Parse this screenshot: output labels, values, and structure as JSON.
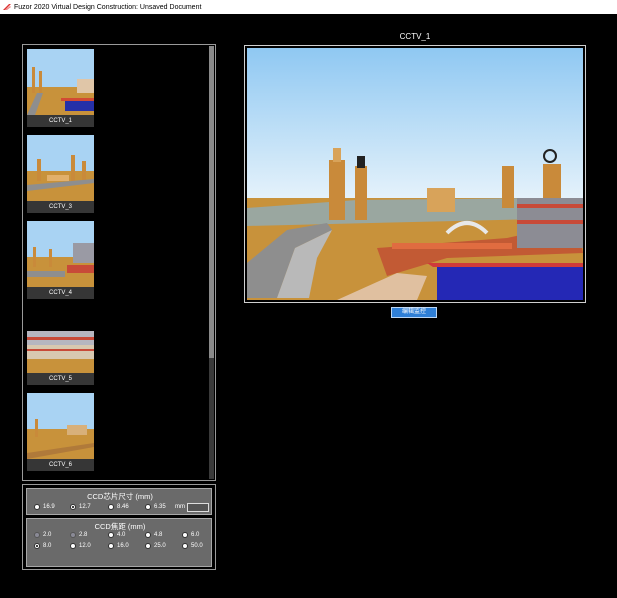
{
  "window": {
    "title": "Fuzor 2020 Virtual Design Construction: Unsaved Document"
  },
  "thumbnails": [
    {
      "label": "CCTV_1"
    },
    {
      "label": "CCTV_3"
    },
    {
      "label": "CCTV_4"
    },
    {
      "label": "CCTV_5"
    },
    {
      "label": "CCTV_6"
    }
  ],
  "main": {
    "title": "CCTV_1",
    "edit_button": "编辑监控"
  },
  "sensor": {
    "title": "CCD芯片尺寸 (mm)",
    "options": [
      "16.9",
      "12.7",
      "8.46",
      "6.35"
    ],
    "selected": "12.7",
    "unit": "mm",
    "custom_value": ""
  },
  "focal": {
    "title": "CCD焦距 (mm)",
    "row1": [
      "2.0",
      "2.8",
      "4.0",
      "4.8",
      "6.0"
    ],
    "row2": [
      "8.0",
      "12.0",
      "16.0",
      "25.0",
      "50.0"
    ],
    "selected": "8.0",
    "disabled": [
      "2.0",
      "2.8"
    ]
  }
}
